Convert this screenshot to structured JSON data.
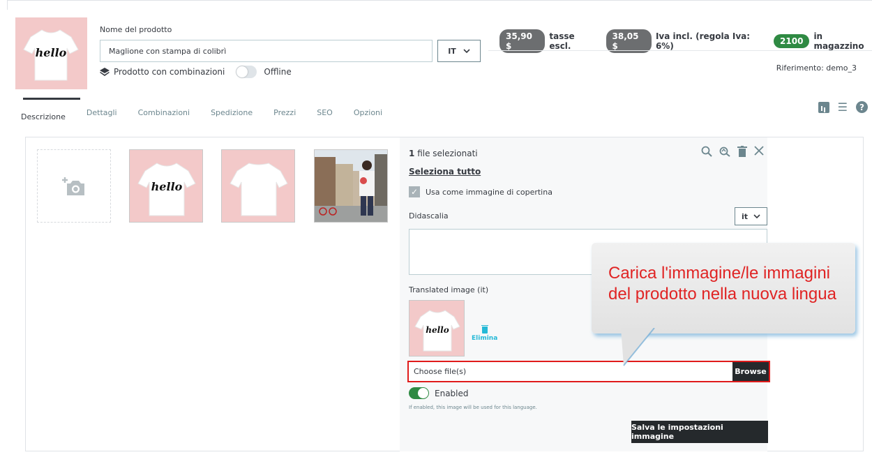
{
  "product": {
    "name_label": "Nome del prodotto",
    "name_value": "Maglione con stampa di colibrì",
    "lang": "IT",
    "combinations_label": "Prodotto con combinazioni",
    "status_label": "Offline",
    "tshirt_print": "hello"
  },
  "pricing": {
    "price_excl": "35,90 $",
    "excl_label": "tasse escl.",
    "price_incl": "38,05 $",
    "incl_label": "Iva incl. (regola Iva: 6%)",
    "stock": "2100",
    "stock_label": "in magazzino",
    "reference": "Riferimento: demo_3"
  },
  "tabs": [
    "Descrizione",
    "Dettagli",
    "Combinazioni",
    "Spedizione",
    "Prezzi",
    "SEO",
    "Opzioni"
  ],
  "images_panel": {
    "selected_count": "1",
    "selected_label": "file selezionati",
    "select_all": "Seleziona tutto",
    "cover_label": "Usa come immagine di copertina",
    "caption_label": "Didascalia",
    "caption_lang": "it",
    "translated_label": "Translated image (it)",
    "delete_label": "Elimina",
    "file_placeholder": "Choose file(s)",
    "browse_label": "Browse",
    "enabled_label": "Enabled",
    "enabled_hint": "If enabled, this image will be used for this language.",
    "save_label": "Salva le impostazioni immagine"
  },
  "callout": {
    "line1": "Carica l'immagine/le immagini",
    "line2": "del prodotto nella nuova lingua"
  },
  "colors": {
    "accent": "#25b9d7",
    "dark_button": "#25292c",
    "green": "#2f8a43",
    "highlight_red": "#e01b1b",
    "tshirt_bg": "#f3c9c9"
  }
}
